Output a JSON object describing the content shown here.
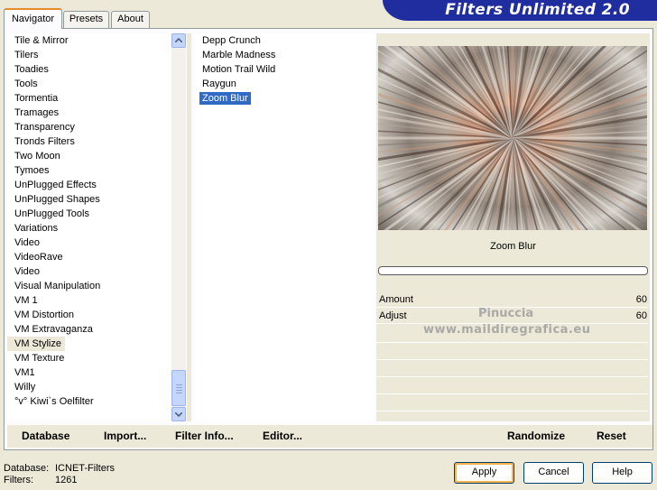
{
  "tabs": [
    "Navigator",
    "Presets",
    "About"
  ],
  "banner_title": "Filters Unlimited 2.0",
  "categories": [
    "Tile & Mirror",
    "Tilers",
    "Toadies",
    "Tools",
    "Tormentia",
    "Tramages",
    "Transparency",
    "Tronds Filters",
    "Two Moon",
    "Tymoes",
    "UnPlugged Effects",
    "UnPlugged Shapes",
    "UnPlugged Tools",
    "Variations",
    "Video",
    "VideoRave",
    "Video",
    "Visual Manipulation",
    "VM 1",
    "VM Distortion",
    "VM Extravaganza",
    "VM Stylize",
    "VM Texture",
    "VM1",
    "Willy",
    "°v° Kiwi`s Oelfilter"
  ],
  "selected_category": "VM Stylize",
  "filters": [
    "Depp Crunch",
    "Marble Madness",
    "Motion Trail Wild",
    "Raygun",
    "Zoom Blur"
  ],
  "selected_filter": "Zoom Blur",
  "preview_title": "Zoom Blur",
  "params": [
    {
      "label": "Amount",
      "value": "60"
    },
    {
      "label": "Adjust",
      "value": "60"
    }
  ],
  "watermark": {
    "line1": "Pinuccia",
    "line2": "www.maildiregrafica.eu"
  },
  "bottom_links": {
    "database": "Database",
    "import": "Import...",
    "filter_info": "Filter Info...",
    "editor": "Editor...",
    "randomize": "Randomize",
    "reset": "Reset"
  },
  "status": {
    "database_label": "Database:",
    "database_value": "ICNET-Filters",
    "filters_label": "Filters:",
    "filters_value": "1261"
  },
  "buttons": {
    "apply": "Apply",
    "cancel": "Cancel",
    "help": "Help"
  },
  "colors": {
    "banner": "#1f2d9e",
    "selection": "#316ac5",
    "tab_accent": "#e68b2c"
  }
}
